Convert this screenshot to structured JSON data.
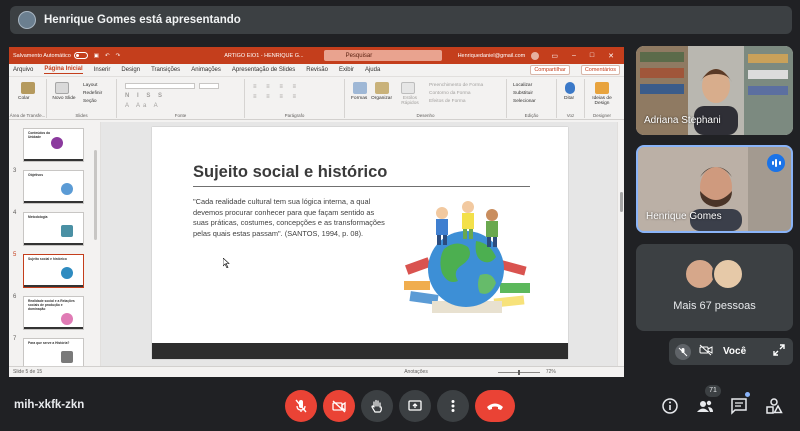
{
  "presenter": {
    "text": "Henrique Gomes está apresentando"
  },
  "ppt": {
    "autosave": "Salvamento Automático",
    "doc_title": "ARTIGO EIO1 - HENRIQUE G...",
    "search": "Pesquisar",
    "email": "Henriquedaniel@gmail.com",
    "tabs": [
      "Arquivo",
      "Página Inicial",
      "Inserir",
      "Design",
      "Transições",
      "Animações",
      "Apresentação de Slides",
      "Revisão",
      "Exibir",
      "Ajuda"
    ],
    "active_tab": "Página Inicial",
    "share": "Compartilhar",
    "comments": "Comentários",
    "ribbon": {
      "paste": "Colar",
      "new_slide": "Novo Slide",
      "layout": "Layout",
      "reset": "Redefinir",
      "section": "Seção",
      "shapes": "Formas",
      "arrange": "Organizar",
      "quick_styles": "Estilos Rápidos",
      "shape_fill": "Preenchimento de Forma",
      "shape_outline": "Contorno da Forma",
      "shape_effects": "Efeitos de Forma",
      "find": "Localizar",
      "replace": "Substituir",
      "select": "Selecionar",
      "dictate": "Ditar",
      "designer": "Ideias de Design",
      "groups": [
        "Área de Transfe...",
        "Slides",
        "Fonte",
        "Parágrafo",
        "Desenho",
        "Edição",
        "Voz",
        "Designer"
      ]
    },
    "thumbnails": [
      {
        "num": "",
        "title": "Conteúdos da Unidade"
      },
      {
        "num": "3",
        "title": "Objetivos"
      },
      {
        "num": "4",
        "title": "Metodologia"
      },
      {
        "num": "5",
        "title": "Sujeito social e histórico"
      },
      {
        "num": "6",
        "title": "Realidade social e a Relações sociais de produção e dominação"
      },
      {
        "num": "7",
        "title": "Para que serve a História?"
      }
    ],
    "slide": {
      "title": "Sujeito social e histórico",
      "quote": "\"Cada realidade cultural tem sua lógica interna, a qual devemos procurar conhecer para que façam sentido as suas práticas, costumes, concepções e as transformações pelas quais estas passam\". (SANTOS, 1994, p. 08)."
    },
    "status": {
      "slide": "Slide 5 de 15",
      "notes": "Anotações",
      "zoom": "72%"
    }
  },
  "participants": [
    {
      "name": "Adriana Stephani"
    },
    {
      "name": "Henrique Gomes"
    }
  ],
  "more": {
    "label": "Mais 67 pessoas"
  },
  "self": {
    "label": "Você"
  },
  "meeting": {
    "code": "mih-xkfk-zkn",
    "people_count": "71"
  },
  "colors": {
    "end_call": "#ea4335",
    "accent": "#8ab4f8",
    "ppt_brand": "#c43e1c"
  }
}
